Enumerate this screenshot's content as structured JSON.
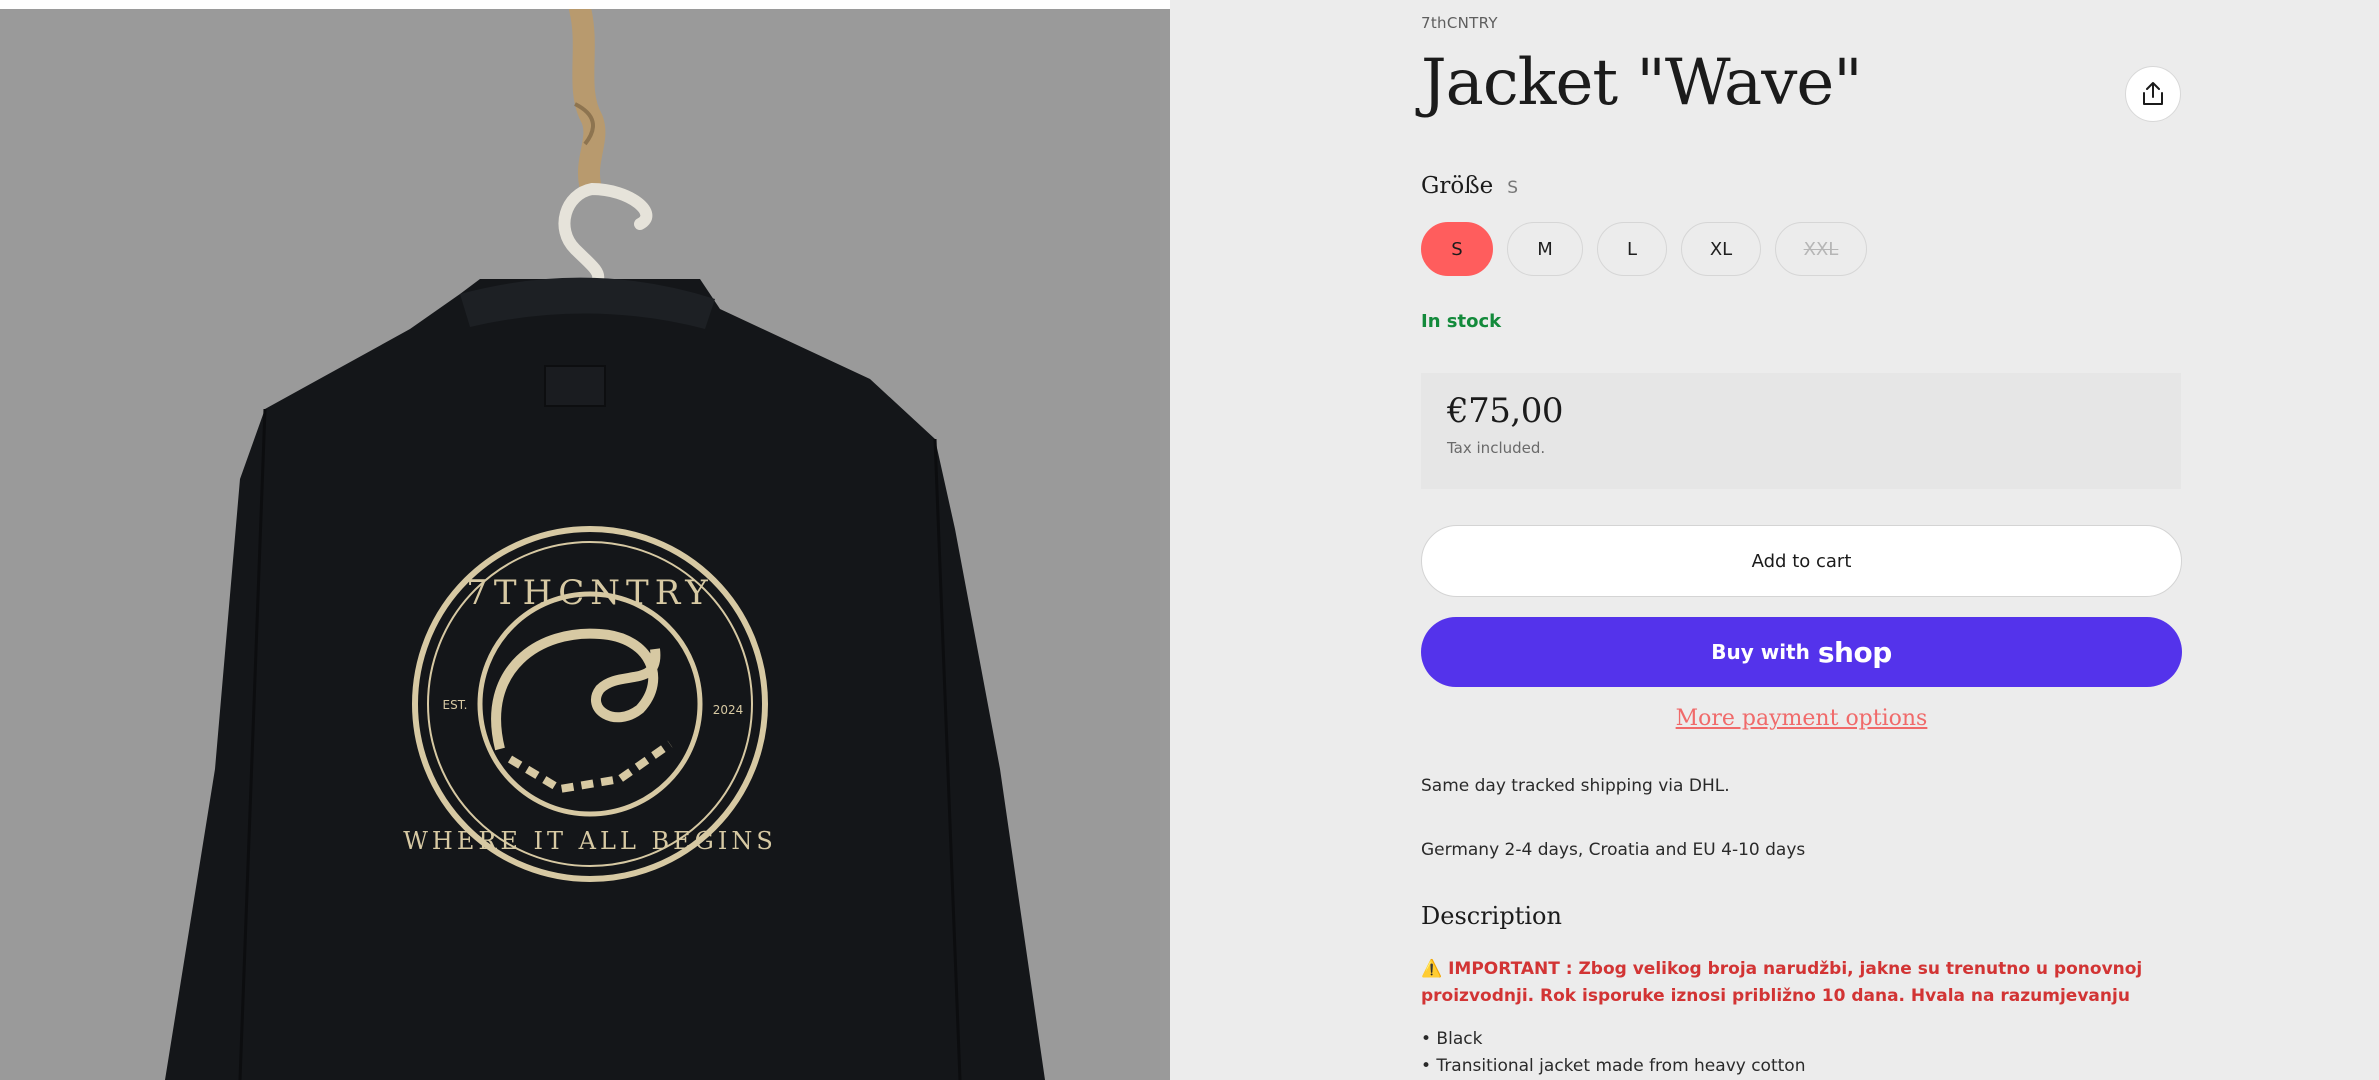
{
  "product": {
    "vendor": "7thCNTRY",
    "title": "Jacket \"Wave\"",
    "share_icon": "share-icon",
    "size_label": "Größe",
    "selected_size": "S",
    "sizes": [
      {
        "label": "S",
        "state": "selected"
      },
      {
        "label": "M",
        "state": "available"
      },
      {
        "label": "L",
        "state": "available"
      },
      {
        "label": "XL",
        "state": "available"
      },
      {
        "label": "XXL",
        "state": "sold-out"
      }
    ],
    "stock_status": "In stock",
    "price": "€75,00",
    "tax_note": "Tax included.",
    "add_to_cart": "Add to cart",
    "buy_with": "Buy with",
    "shop_brand": "shop",
    "more_payment": "More payment options",
    "shipping_line_1": "Same day tracked shipping via DHL.",
    "shipping_line_2": "Germany 2-4 days, Croatia and EU 4-10 days",
    "description_title": "Description",
    "important_notice": "⚠️ IMPORTANT : Zbog velikog broja narudžbi, jakne su trenutno u ponovnoj proizvodnji. Rok isporuke iznosi približno 10 dana.  Hvala na razumjevanju",
    "bullet_1": "• Black",
    "bullet_2": "• Transitional jacket made from heavy cotton"
  },
  "image": {
    "alt": "black jacket back with embroidered wave logo",
    "logo_top_text": "7THCNTRY",
    "logo_bottom_text": "WHERE IT ALL BEGINS",
    "logo_left_text": "EST.",
    "logo_right_text": "2024"
  },
  "colors": {
    "accent_selected": "#ff5d5d",
    "shop_purple": "#5433eb",
    "in_stock_green": "#138a3b",
    "notice_red": "#d23434",
    "link_coral": "#f06a6a"
  }
}
